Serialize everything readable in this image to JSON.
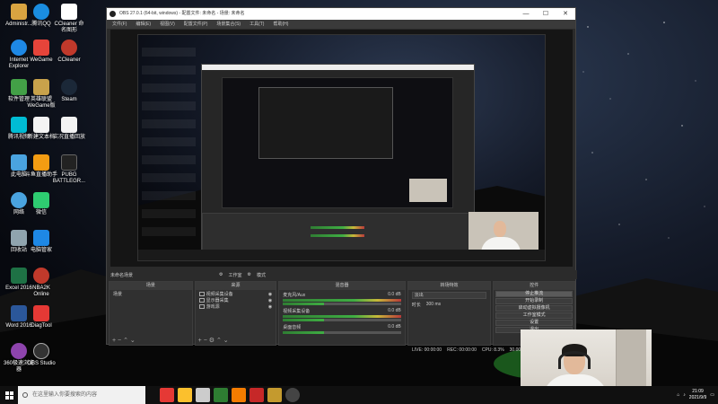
{
  "desktop": {
    "icons": [
      {
        "label": "Administr...",
        "color": "#d9a441"
      },
      {
        "label": "腾讯QQ",
        "color": "#1a8de0"
      },
      {
        "label": "CCleaner 命 名图形",
        "color": "#ffffff"
      },
      {
        "label": "Internet Explorer",
        "color": "#1e88e5"
      },
      {
        "label": "WeGame",
        "color": "#e6443a"
      },
      {
        "label": "CCleaner",
        "color": "#c0392b"
      },
      {
        "label": "软件管理",
        "color": "#43a047"
      },
      {
        "label": "英雄联盟 WeGame版",
        "color": "#c8a24b"
      },
      {
        "label": "Steam",
        "color": "#1b2838"
      },
      {
        "label": "腾讯视频",
        "color": "#00bcd4"
      },
      {
        "label": "新建文本档",
        "color": "#f3f3f3"
      },
      {
        "label": "实况直播回放",
        "color": "#f3f3f3"
      },
      {
        "label": "此电脑",
        "color": "#4aa3df"
      },
      {
        "label": "斗鱼直播助手",
        "color": "#f39c12"
      },
      {
        "label": "PUBG BATTLEGR...",
        "color": "#222222"
      },
      {
        "label": "网络",
        "color": "#4aa3df"
      },
      {
        "label": "微信",
        "color": "#2ecc71"
      },
      {
        "label": "回收站",
        "color": "#90a4ae"
      },
      {
        "label": "电脑管家",
        "color": "#1e88e5"
      },
      {
        "label": "Excel 2016",
        "color": "#1e7145"
      },
      {
        "label": "NBA2K Online",
        "color": "#c0392b"
      },
      {
        "label": "Word 2016",
        "color": "#2b579a"
      },
      {
        "label": "DiagTool",
        "color": "#e53935"
      },
      {
        "label": "360极速浏览器",
        "color": "#8e44ad"
      },
      {
        "label": "OBS Studio",
        "color": "#333333"
      }
    ]
  },
  "obs": {
    "title": "OBS 27.0.1 (64-bit, windows) - 配置文件: 未命名 - 场景: 未命名",
    "menu": [
      "文件(F)",
      "编辑(E)",
      "视图(V)",
      "配置文件(P)",
      "场景集合(S)",
      "工具(T)",
      "帮助(H)"
    ],
    "scene_bar": {
      "label": "未命名场景",
      "studio_mode": "工作室",
      "mode_label": "模式"
    },
    "docks": {
      "scenes": {
        "title": "场景",
        "items": [
          "场景"
        ]
      },
      "sources": {
        "title": "来源",
        "items": [
          "视频采集设备",
          "显示器采集",
          "游戏源"
        ]
      },
      "mixer": {
        "title": "混音器",
        "channels": [
          {
            "name": "麦克风/Aux",
            "db": "0.0 dB"
          },
          {
            "name": "视频采集设备",
            "db": "0.0 dB"
          },
          {
            "name": "桌面音频",
            "db": "0.0 dB"
          }
        ]
      },
      "transitions": {
        "title": "转场特效",
        "type": "淡出",
        "duration_label": "时长",
        "duration": "300 ms"
      },
      "controls": {
        "title": "控件",
        "buttons": [
          "停止推流",
          "开始录制",
          "启动虚拟摄像机",
          "工作室模式",
          "设置",
          "退出"
        ]
      }
    },
    "status": {
      "live": "LIVE: 00:00:00",
      "rec": "REC: 00:00:00",
      "cpu": "CPU: 8.3%",
      "fps": "30.00 fps"
    }
  },
  "taskbar": {
    "search_placeholder": "在这里输入你要搜索的内容",
    "time": "21:09",
    "date": "2021/9/9",
    "app_colors": [
      "#e53935",
      "#fbc02d",
      "#cccccc",
      "#2e7d32",
      "#f57c00",
      "#c62828",
      "#c49a2e",
      "#444444"
    ]
  }
}
